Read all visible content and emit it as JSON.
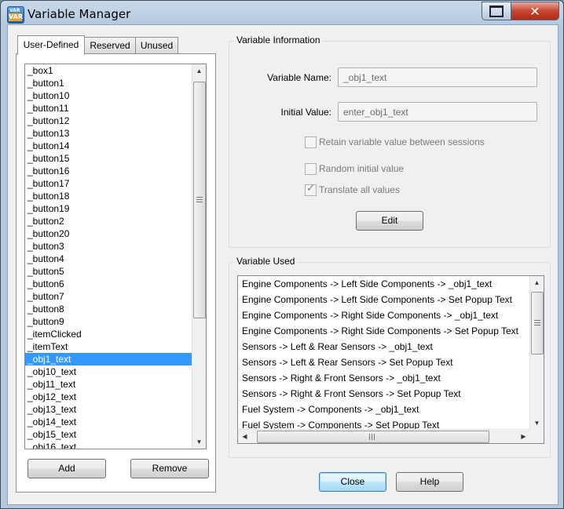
{
  "window": {
    "title": "Variable Manager",
    "icon_top_text": "VAR",
    "icon_text": "VAR",
    "close_glyph": "✕"
  },
  "tabs": [
    {
      "label": "User-Defined",
      "active": true
    },
    {
      "label": "Reserved",
      "active": false
    },
    {
      "label": "Unused",
      "active": false
    }
  ],
  "variables": [
    "_box1",
    "_button1",
    "_button10",
    "_button11",
    "_button12",
    "_button13",
    "_button14",
    "_button15",
    "_button16",
    "_button17",
    "_button18",
    "_button19",
    "_button2",
    "_button20",
    "_button3",
    "_button4",
    "_button5",
    "_button6",
    "_button7",
    "_button8",
    "_button9",
    "_itemClicked",
    "_itemText",
    "_obj1_text",
    "_obj10_text",
    "_obj11_text",
    "_obj12_text",
    "_obj13_text",
    "_obj14_text",
    "_obj15_text",
    "_obj16_text"
  ],
  "selected_variable": "_obj1_text",
  "buttons": {
    "add": "Add",
    "remove": "Remove",
    "edit": "Edit",
    "close": "Close",
    "help": "Help"
  },
  "variable_information": {
    "title": "Variable Information",
    "name_label": "Variable Name:",
    "name_value": "_obj1_text",
    "initial_label": "Initial Value:",
    "initial_value": "enter_obj1_text",
    "retain_label": "Retain variable value between sessions",
    "retain_checked": false,
    "random_label": "Random initial value",
    "random_checked": false,
    "translate_label": "Translate all values",
    "translate_checked": true
  },
  "variable_used": {
    "title": "Variable Used",
    "items": [
      "Engine Components -> Left Side Components -> _obj1_text",
      "Engine Components -> Left Side Components -> Set Popup Text",
      "Engine Components -> Right Side Components -> _obj1_text",
      "Engine Components -> Right Side Components -> Set Popup Text",
      "Sensors -> Left & Rear Sensors -> _obj1_text",
      "Sensors -> Left & Rear Sensors -> Set Popup Text",
      "Sensors -> Right & Front Sensors -> _obj1_text",
      "Sensors -> Right & Front Sensors -> Set Popup Text",
      "Fuel System -> Components -> _obj1_text",
      "Fuel System -> Components -> Set Popup Text"
    ]
  },
  "icons": {
    "up": "▲",
    "down": "▼",
    "left": "◀",
    "right": "▶",
    "check": "✓"
  }
}
